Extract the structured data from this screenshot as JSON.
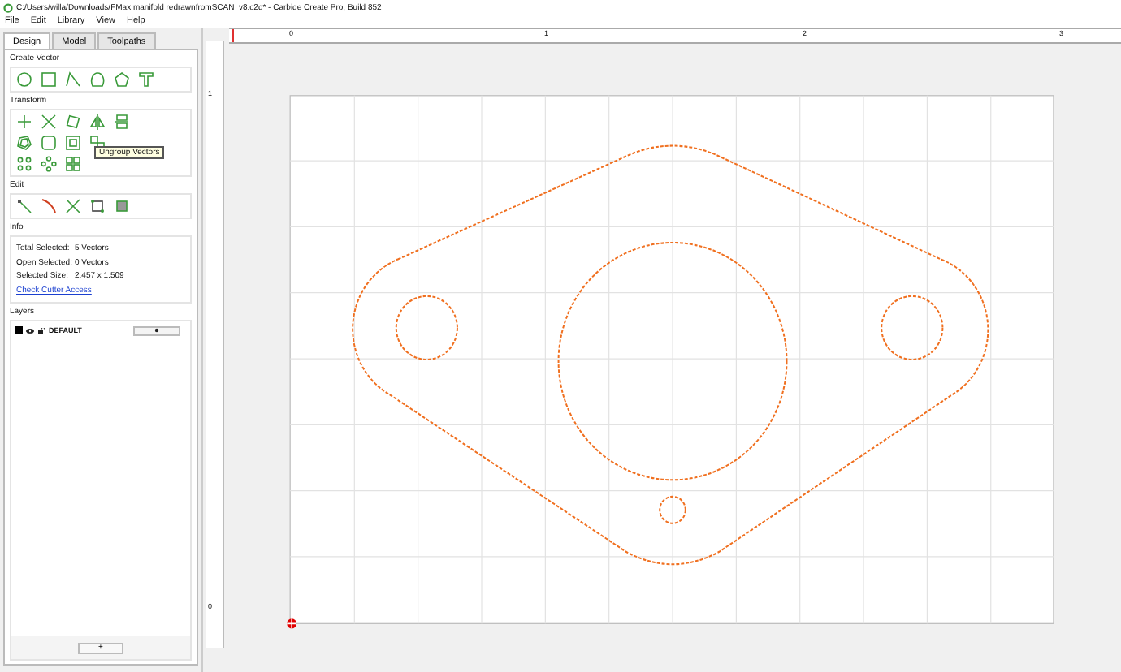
{
  "window": {
    "title": "C:/Users/willa/Downloads/FMax manifold redrawnfromSCAN_v8.c2d* - Carbide Create Pro, Build 852"
  },
  "menu": [
    "File",
    "Edit",
    "Library",
    "View",
    "Help"
  ],
  "tabs": [
    {
      "label": "Design",
      "selected": true
    },
    {
      "label": "Model",
      "selected": false
    },
    {
      "label": "Toolpaths",
      "selected": false
    }
  ],
  "sections": {
    "create_vector": "Create Vector",
    "transform": "Transform",
    "edit": "Edit",
    "info": "Info",
    "layers": "Layers"
  },
  "tooltip": "Ungroup Vectors",
  "info": [
    {
      "label": "Total Selected:",
      "value": "5 Vectors"
    },
    {
      "label": "Open Selected:",
      "value": "0 Vectors"
    },
    {
      "label": "Selected Size:",
      "value": "2.457 x 1.509"
    }
  ],
  "check_link": "Check Cutter Access",
  "layers": [
    {
      "name": "DEFAULT",
      "color": "#000000",
      "visible": true
    }
  ],
  "add_layer_button": "+",
  "ruler": {
    "x_labels": [
      "0",
      "1",
      "2",
      "3"
    ],
    "y_labels": [
      "1",
      "0"
    ]
  }
}
